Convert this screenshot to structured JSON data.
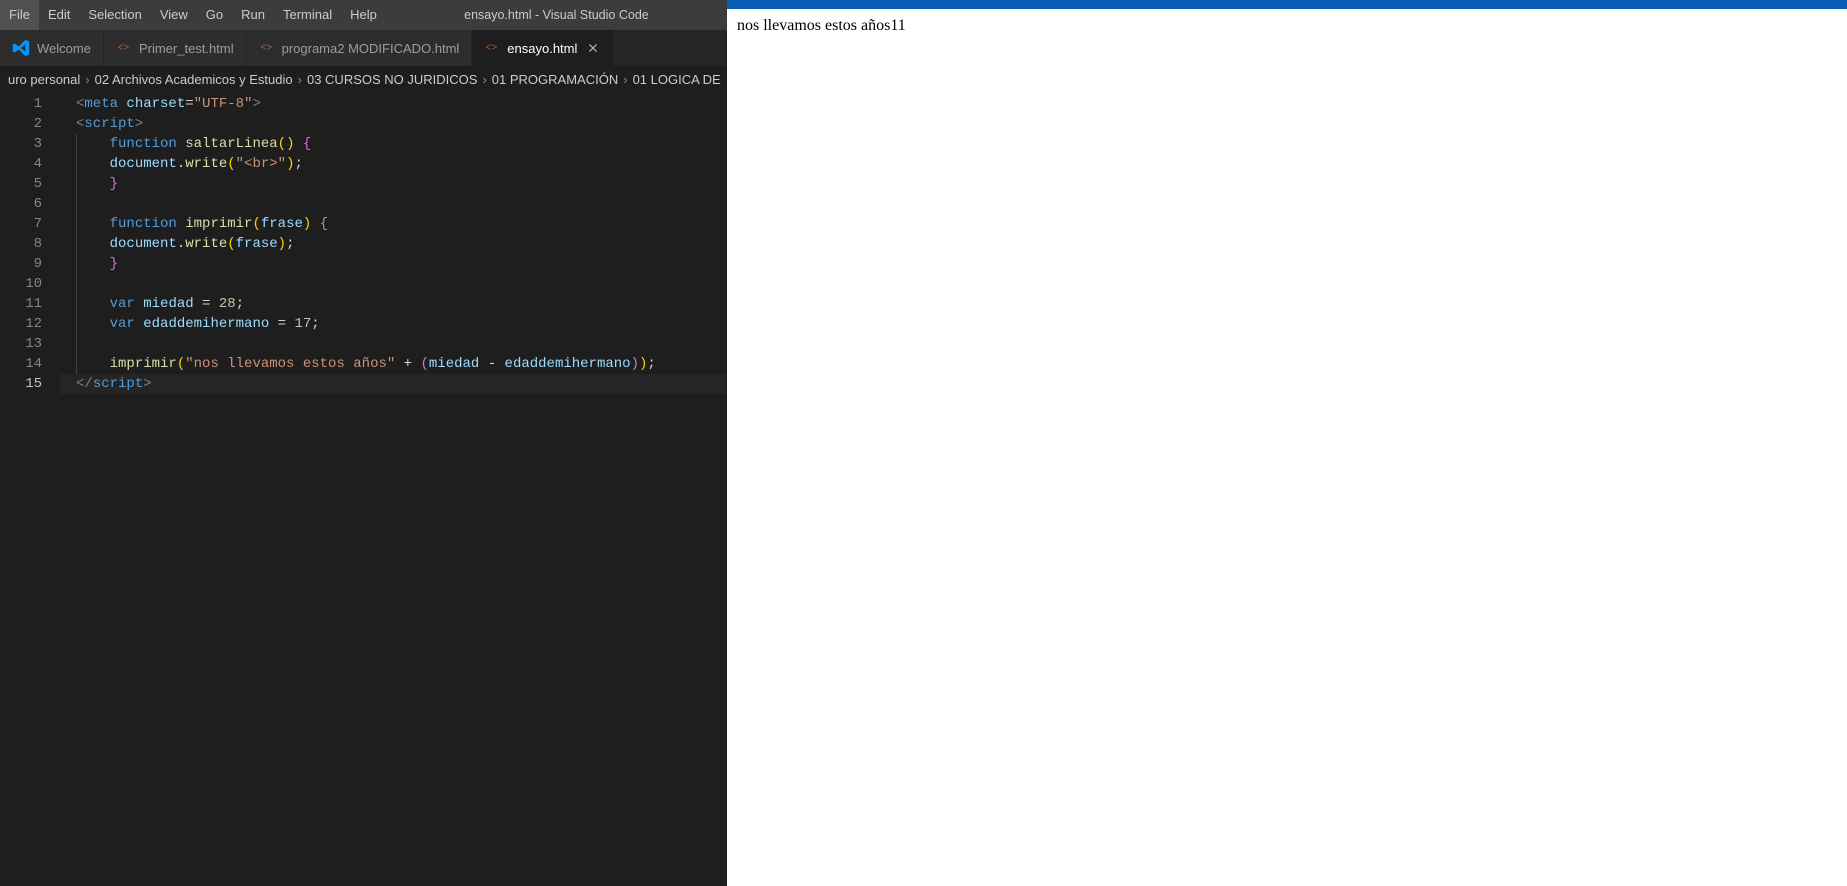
{
  "window_title": "ensayo.html - Visual Studio Code",
  "menu": [
    "File",
    "Edit",
    "Selection",
    "View",
    "Go",
    "Run",
    "Terminal",
    "Help"
  ],
  "tabs": [
    {
      "label": "Welcome",
      "type": "welcome",
      "active": false
    },
    {
      "label": "Primer_test.html",
      "type": "html",
      "active": false
    },
    {
      "label": "programa2 MODIFICADO.html",
      "type": "html",
      "active": false
    },
    {
      "label": "ensayo.html",
      "type": "html",
      "active": true
    }
  ],
  "breadcrumbs": [
    "uro personal",
    "02 Archivos Academicos y Estudio",
    "03 CURSOS NO JURIDICOS",
    "01 PROGRAMACIÓN",
    "01 LOGICA DE"
  ],
  "browser_output": "nos llevamos estos años11",
  "code": {
    "line_count": 15,
    "current_line": 15,
    "lines": [
      {
        "n": 1,
        "indent": 0,
        "tokens": [
          [
            "punc",
            "<"
          ],
          [
            "tag",
            "meta"
          ],
          [
            "plain",
            " "
          ],
          [
            "attr",
            "charset"
          ],
          [
            "plain",
            "="
          ],
          [
            "str",
            "\"UTF-8\""
          ],
          [
            "punc",
            ">"
          ]
        ]
      },
      {
        "n": 2,
        "indent": 0,
        "tokens": [
          [
            "punc",
            "<"
          ],
          [
            "tag",
            "script"
          ],
          [
            "punc",
            ">"
          ]
        ]
      },
      {
        "n": 3,
        "indent": 1,
        "tokens": [
          [
            "kw",
            "function"
          ],
          [
            "plain",
            " "
          ],
          [
            "fn",
            "saltarLinea"
          ],
          [
            "brk-y",
            "("
          ],
          [
            "brk-y",
            ")"
          ],
          [
            "plain",
            " "
          ],
          [
            "brk",
            "{"
          ]
        ]
      },
      {
        "n": 4,
        "indent": 1,
        "tokens": [
          [
            "var",
            "document"
          ],
          [
            "plain",
            "."
          ],
          [
            "fn",
            "write"
          ],
          [
            "brk-y",
            "("
          ],
          [
            "str",
            "\"<br>\""
          ],
          [
            "brk-y",
            ")"
          ],
          [
            "plain",
            ";"
          ]
        ]
      },
      {
        "n": 5,
        "indent": 1,
        "tokens": [
          [
            "brk",
            "}"
          ]
        ]
      },
      {
        "n": 6,
        "indent": 1,
        "tokens": []
      },
      {
        "n": 7,
        "indent": 1,
        "tokens": [
          [
            "kw",
            "function"
          ],
          [
            "plain",
            " "
          ],
          [
            "fn",
            "imprimir"
          ],
          [
            "brk-y",
            "("
          ],
          [
            "var",
            "frase"
          ],
          [
            "brk-y",
            ")"
          ],
          [
            "plain",
            " "
          ],
          [
            "brk",
            "{"
          ]
        ]
      },
      {
        "n": 8,
        "indent": 1,
        "tokens": [
          [
            "var",
            "document"
          ],
          [
            "plain",
            "."
          ],
          [
            "fn",
            "write"
          ],
          [
            "brk-y",
            "("
          ],
          [
            "var",
            "frase"
          ],
          [
            "brk-y",
            ")"
          ],
          [
            "plain",
            ";"
          ]
        ]
      },
      {
        "n": 9,
        "indent": 1,
        "tokens": [
          [
            "brk",
            "}"
          ]
        ]
      },
      {
        "n": 10,
        "indent": 1,
        "tokens": []
      },
      {
        "n": 11,
        "indent": 1,
        "tokens": [
          [
            "kw",
            "var"
          ],
          [
            "plain",
            " "
          ],
          [
            "var",
            "miedad"
          ],
          [
            "plain",
            " = "
          ],
          [
            "num",
            "28"
          ],
          [
            "plain",
            ";"
          ]
        ]
      },
      {
        "n": 12,
        "indent": 1,
        "tokens": [
          [
            "kw",
            "var"
          ],
          [
            "plain",
            " "
          ],
          [
            "var",
            "edaddemihermano"
          ],
          [
            "plain",
            " = "
          ],
          [
            "num",
            "17"
          ],
          [
            "plain",
            ";"
          ]
        ]
      },
      {
        "n": 13,
        "indent": 1,
        "tokens": []
      },
      {
        "n": 14,
        "indent": 1,
        "tokens": [
          [
            "fn",
            "imprimir"
          ],
          [
            "brk-y",
            "("
          ],
          [
            "str",
            "\"nos llevamos estos años\""
          ],
          [
            "plain",
            " + "
          ],
          [
            "brk",
            "("
          ],
          [
            "var",
            "miedad"
          ],
          [
            "plain",
            " - "
          ],
          [
            "var",
            "edaddemihermano"
          ],
          [
            "brk",
            ")"
          ],
          [
            "brk-y",
            ")"
          ],
          [
            "plain",
            ";"
          ]
        ]
      },
      {
        "n": 15,
        "indent": 0,
        "tokens": [
          [
            "punc",
            "</"
          ],
          [
            "tag",
            "script"
          ],
          [
            "punc",
            ">"
          ]
        ]
      }
    ]
  }
}
